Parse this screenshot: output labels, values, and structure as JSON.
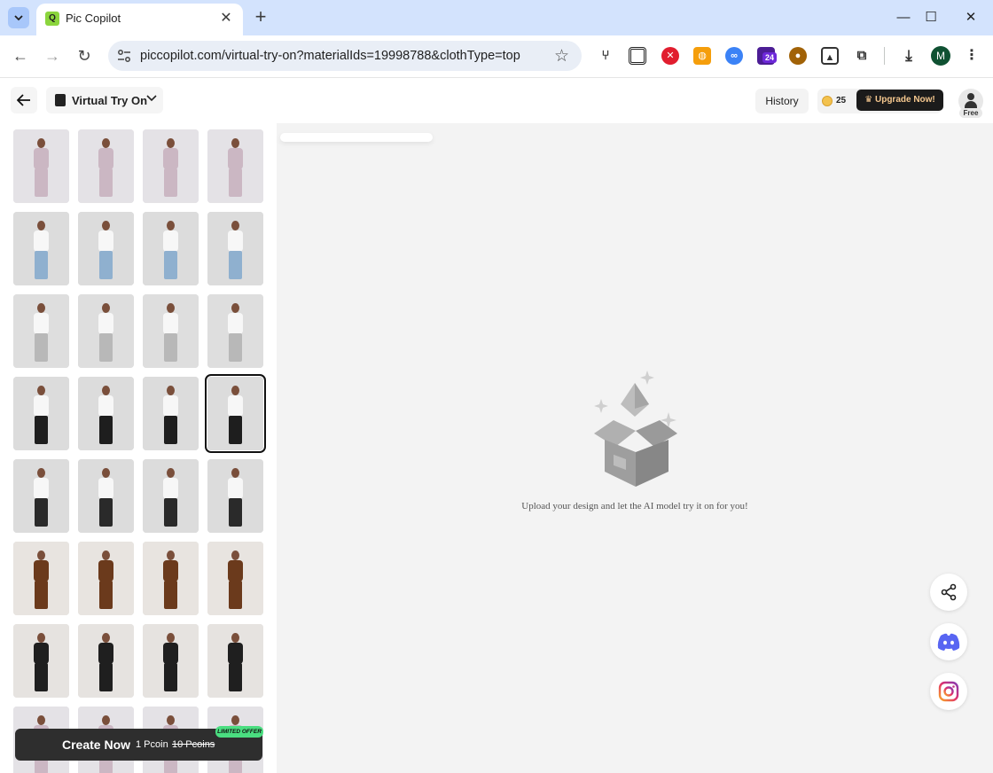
{
  "browser": {
    "tab_title": "Pic Copilot",
    "url": "piccopilot.com/virtual-try-on?materialIds=19998788&clothType=top",
    "profile_initial": "M",
    "extension_badge": "24"
  },
  "header": {
    "tool_name": "Virtual Try On",
    "history_label": "History",
    "coin_count": "25",
    "upgrade_label": "Upgrade Now!",
    "plan_label": "Free"
  },
  "gallery": {
    "selected_index": 15,
    "rows": [
      {
        "style": "lilac-slip-dress"
      },
      {
        "style": "white-tank-denim-shorts"
      },
      {
        "style": "white-tank-grey-joggers"
      },
      {
        "style": "white-tank-black-bottoms"
      },
      {
        "style": "white-tank-leather-skirt"
      },
      {
        "style": "brown-mini-dress"
      },
      {
        "style": "black-bodysuit"
      }
    ]
  },
  "create": {
    "label": "Create Now",
    "price": "1 Pcoin",
    "old_price": "10 Pcoins",
    "offer": "LIMITED OFFER"
  },
  "main": {
    "empty_message": "Upload your design and let the AI model try it on for you!"
  },
  "colors": {
    "tabstrip": "#d3e3fd",
    "accent_dark": "#1b1b1b",
    "offer_green": "#4ade80",
    "canvas": "#f3f3f3"
  }
}
